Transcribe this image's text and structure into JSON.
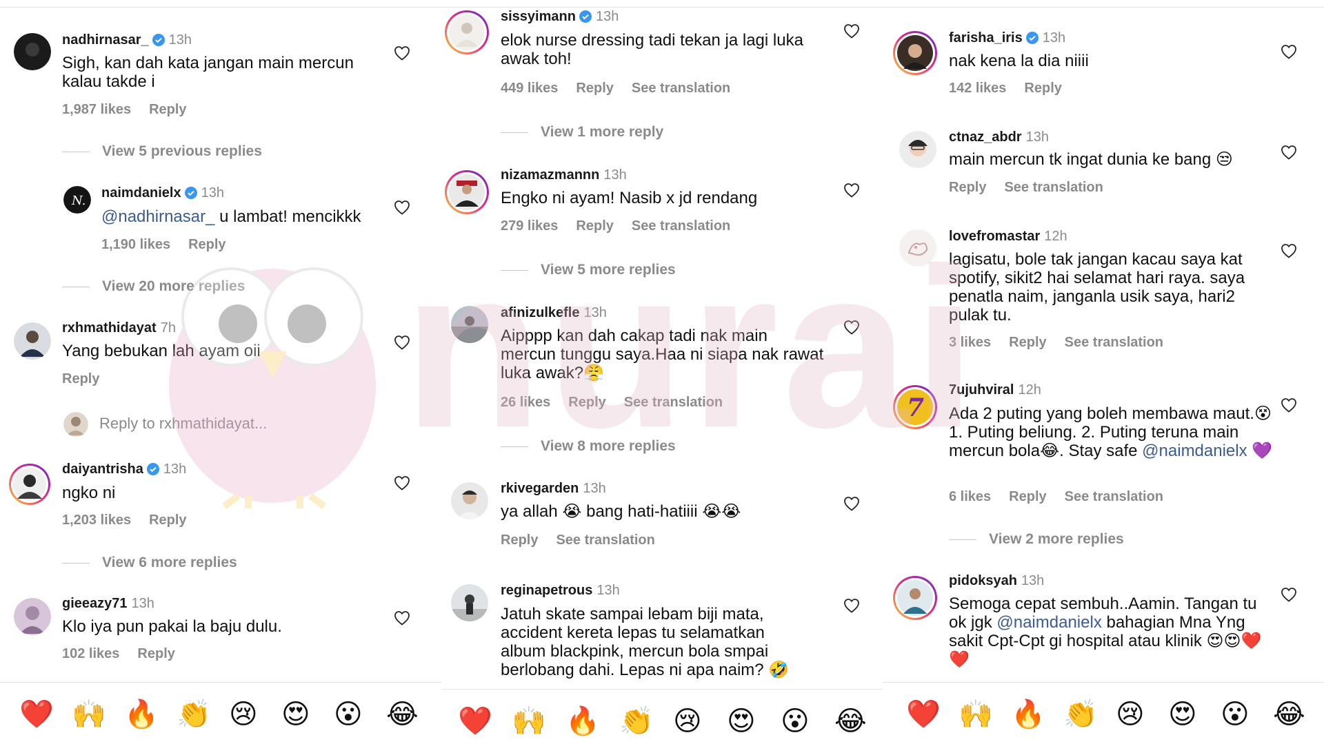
{
  "panel1": {
    "c1": {
      "username": "nadhirnasar_",
      "verified": true,
      "time": "13h",
      "text": "Sigh, kan dah kata jangan main mercun kalau takde i",
      "likes": "1,987 likes",
      "reply": "Reply"
    },
    "view1": "View 5 previous replies",
    "c2": {
      "username": "naimdanielx",
      "verified": true,
      "time": "13h",
      "mention": "@nadhirnasar_",
      "text": " u lambat! mencikkk",
      "likes": "1,190 likes",
      "reply": "Reply"
    },
    "view2": "View 20 more replies",
    "c3": {
      "username": "rxhmathidayat",
      "time": "7h",
      "text": "Yang bebukan lah ayam oii",
      "reply": "Reply"
    },
    "replyto": "Reply to rxhmathidayat...",
    "c4": {
      "username": "daiyantrisha",
      "verified": true,
      "time": "13h",
      "text": "ngko ni",
      "likes": "1,203 likes",
      "reply": "Reply"
    },
    "view3": "View 6 more replies",
    "c5": {
      "username": "gieeazy71",
      "time": "13h",
      "text": "Klo iya pun pakai la baju dulu.",
      "likes": "102 likes",
      "reply": "Reply"
    }
  },
  "panel2": {
    "c1": {
      "username": "sissyimann",
      "verified": true,
      "time": "13h",
      "text": "elok nurse dressing tadi tekan ja lagi luka awak toh!",
      "likes": "449 likes",
      "reply": "Reply",
      "translation": "See translation"
    },
    "view1": "View 1 more reply",
    "c2": {
      "username": "nizamazmannn",
      "time": "13h",
      "text": "Engko ni ayam! Nasib x jd rendang",
      "likes": "279 likes",
      "reply": "Reply",
      "translation": "See translation"
    },
    "view2": "View 5 more replies",
    "c3": {
      "username": "afinizulkefle",
      "time": "13h",
      "text": "Aipppp kan dah cakap tadi nak main mercun tunggu saya.Haa ni siapa nak rawat luka awak?😤",
      "likes": "26 likes",
      "reply": "Reply",
      "translation": "See translation"
    },
    "view3": "View 8 more replies",
    "c4": {
      "username": "rkivegarden",
      "time": "13h",
      "text": "ya allah 😭 bang hati-hatiiii 😭😭",
      "reply": "Reply",
      "translation": "See translation"
    },
    "c5": {
      "username": "reginapetrous",
      "time": "13h",
      "text": "Jatuh skate sampai lebam biji mata, accident kereta lepas tu selamatkan album blackpink, mercun bola smpai berlobang dahi. Lepas ni apa naim? 🤣"
    }
  },
  "panel3": {
    "c1": {
      "username": "farisha_iris",
      "verified": true,
      "time": "13h",
      "text": "nak kena la dia niiii",
      "likes": "142 likes",
      "reply": "Reply"
    },
    "c2": {
      "username": "ctnaz_abdr",
      "time": "13h",
      "text": "main mercun tk ingat dunia ke bang 😒",
      "reply": "Reply",
      "translation": "See translation"
    },
    "c3": {
      "username": "lovefromastar",
      "time": "12h",
      "text": "lagisatu, bole tak jangan kacau saya kat spotify, sikit2 hai selamat hari raya. saya penatla naim, janganla usik saya, hari2 pulak tu.",
      "likes": "3 likes",
      "reply": "Reply",
      "translation": "See translation"
    },
    "c4": {
      "username": "7ujuhviral",
      "time": "12h",
      "text": "Ada 2 puting yang boleh membawa maut.😵 1. Puting beliung. 2. Puting teruna main mercun bola😂. Stay safe ",
      "mention": "@naimdanielx",
      "after": " 💜",
      "likes": "6 likes",
      "reply": "Reply",
      "translation": "See translation"
    },
    "view1": "View 2 more replies",
    "c5": {
      "username": "pidoksyah",
      "time": "13h",
      "text_a": "Semoga cepat sembuh..Aamin.  Tangan tu ok jgk ",
      "mention": "@naimdanielx",
      "text_b": "  bahagian Mna Yng sakit  Cpt-Cpt gi hospital atau klinik 😍😍❤️❤️"
    }
  },
  "emojis": [
    "❤️",
    "🙌",
    "🔥",
    "👏",
    "😢",
    "😍",
    "😮",
    "😂"
  ],
  "watermark": "nurai",
  "colors": {
    "muted": "#8a8a8a",
    "mention": "#3b5b93",
    "verified": "#3897f0",
    "heart": "#262626"
  }
}
